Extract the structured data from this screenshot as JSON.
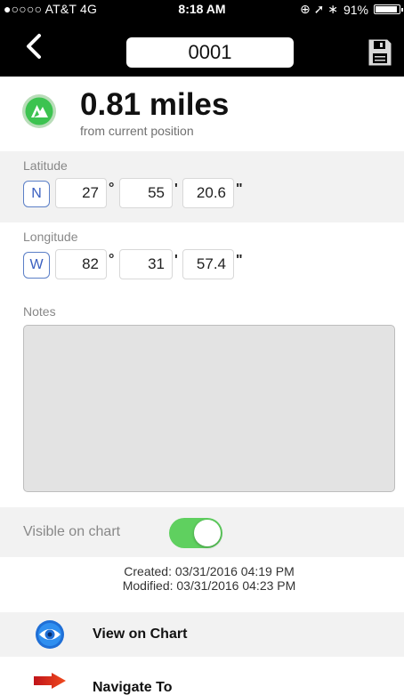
{
  "status_bar": {
    "carrier": "●○○○○ AT&T  4G",
    "time": "8:18 AM",
    "right_icons": "⊕ ➚ ∗",
    "battery": "91%",
    "battery_level": 0.91
  },
  "nav_bar": {
    "title": "0001",
    "back_icon": "chevron-left-icon",
    "save_icon": "floppy-disk-icon"
  },
  "distance": {
    "value": "0.81 miles",
    "subtitle": "from current position",
    "icon": "position-marker-icon",
    "accent": "#3cc350"
  },
  "latitude": {
    "label": "Latitude",
    "hemisphere": "N",
    "degrees": "27",
    "minutes": "55",
    "seconds": "20.6",
    "deg_unit": "°",
    "min_unit": "'",
    "sec_unit": "\""
  },
  "longitude": {
    "label": "Longitude",
    "hemisphere": "W",
    "degrees": "82",
    "minutes": "31",
    "seconds": "57.4",
    "deg_unit": "°",
    "min_unit": "'",
    "sec_unit": "\""
  },
  "notes": {
    "label": "Notes",
    "value": ""
  },
  "visible": {
    "label": "Visible on chart",
    "on": true,
    "toggle_color": "#5fd05f"
  },
  "dates": {
    "created": "Created: 03/31/2016 04:19 PM",
    "modified": "Modified: 03/31/2016 04:23 PM"
  },
  "actions": {
    "view_on_chart": {
      "label": "View on Chart",
      "icon": "eye-icon"
    },
    "navigate_to": {
      "label": "Navigate To",
      "icon": "arrow-right-icon"
    }
  }
}
